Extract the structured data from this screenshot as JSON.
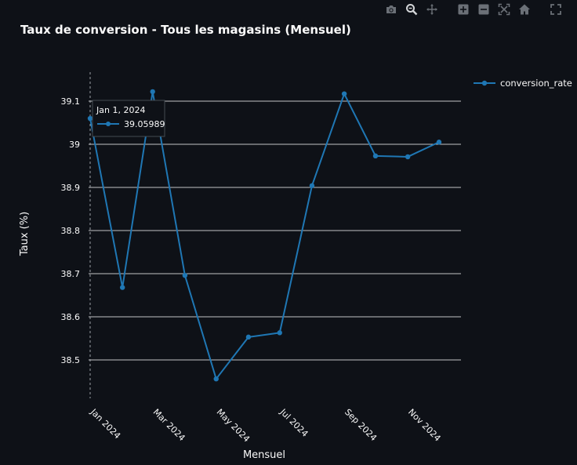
{
  "toolbar": {
    "icons": [
      "camera-icon",
      "zoom-icon",
      "pan-icon",
      "zoom-in-icon",
      "zoom-out-icon",
      "autoscale-icon",
      "home-icon",
      "fullscreen-icon"
    ]
  },
  "colors": {
    "background": "#0e1117",
    "line": "#1f77b4",
    "grid": "#ffffff",
    "text": "#fafafa",
    "toolbar_icon": "#6b7077",
    "toolbar_active": "#d4d6d9"
  },
  "chart_data": {
    "type": "line",
    "title": "Taux de conversion - Tous les magasins (Mensuel)",
    "xlabel": "Mensuel",
    "ylabel": "Taux (%)",
    "x": [
      "2024-01-01",
      "2024-02-01",
      "2024-03-01",
      "2024-04-01",
      "2024-05-01",
      "2024-06-01",
      "2024-07-01",
      "2024-08-01",
      "2024-09-01",
      "2024-10-01",
      "2024-11-01",
      "2024-12-01"
    ],
    "x_tick_labels": [
      "Jan 2024",
      "Mar 2024",
      "May 2024",
      "Jul 2024",
      "Sep 2024",
      "Nov 2024"
    ],
    "y_tick_labels": [
      "38.5",
      "38.6",
      "38.7",
      "38.8",
      "38.9",
      "39",
      "39.1"
    ],
    "ylim": [
      38.41,
      39.2
    ],
    "grid": true,
    "legend_position": "top-right",
    "series": [
      {
        "name": "conversion_rate",
        "values": [
          39.05989,
          38.668,
          39.122,
          38.696,
          38.456,
          38.553,
          38.563,
          38.904,
          39.117,
          38.973,
          38.971,
          39.005
        ]
      }
    ],
    "tooltip": {
      "date": "Jan 1, 2024",
      "value": "39.05989"
    }
  }
}
